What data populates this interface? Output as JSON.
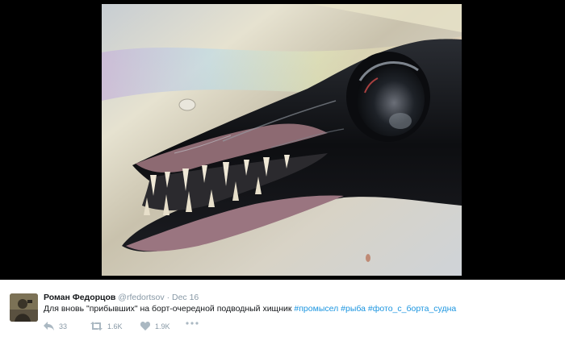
{
  "tweet": {
    "author_name": "Роман Федорцов",
    "handle": "@rfedortsov",
    "separator": "·",
    "date": "Dec 16",
    "text_plain": "Для вновь \"прибывших\" на борт-очередной подводный хищник ",
    "hashtags": [
      "#промысел",
      "#рыба",
      "#фото_с_борта_судна"
    ],
    "hashtag_color": "#1b95e0"
  },
  "actions": {
    "reply_icon": "reply-icon",
    "reply_count": "33",
    "retweet_icon": "retweet-icon",
    "retweet_count": "1.6K",
    "like_icon": "heart-icon",
    "like_count": "1.9K",
    "more_icon": "more-icon"
  },
  "media": {
    "background": "#000000",
    "image_subject": "fish-head-photo"
  }
}
